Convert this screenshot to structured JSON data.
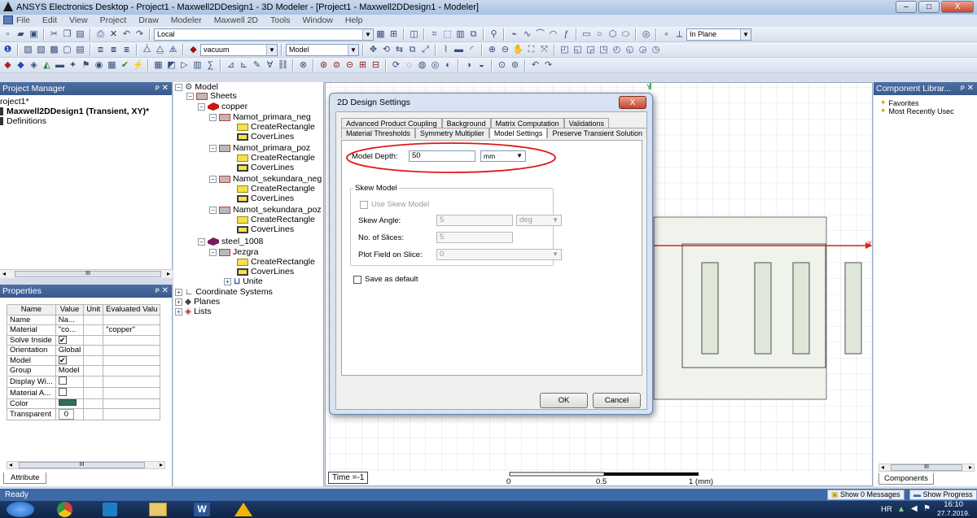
{
  "window": {
    "title": "ANSYS Electronics Desktop - Project1 - Maxwell2DDesign1 - 3D Modeler - [Project1 - Maxwell2DDesign1 - Modeler]",
    "min": "–",
    "max": "□",
    "close": "X"
  },
  "menu": [
    "File",
    "Edit",
    "View",
    "Project",
    "Draw",
    "Modeler",
    "Maxwell 2D",
    "Tools",
    "Window",
    "Help"
  ],
  "toolbar": {
    "coord_combo": "Local",
    "plane_combo": "In Plane",
    "material_combo": "vacuum",
    "model_combo": "Model"
  },
  "project_manager": {
    "title": "Project Manager",
    "project": "roject1*",
    "design": "Maxwell2DDesign1 (Transient, XY)*",
    "definitions": "Definitions",
    "scroll_mark": "III"
  },
  "model_tree": {
    "root": "Model",
    "sheets": "Sheets",
    "copper": "copper",
    "objects": [
      {
        "name": "Namot_primara_neg",
        "ops": [
          "CreateRectangle",
          "CoverLines"
        ]
      },
      {
        "name": "Namot_primara_poz",
        "ops": [
          "CreateRectangle",
          "CoverLines"
        ]
      },
      {
        "name": "Namot_sekundara_neg",
        "ops": [
          "CreateRectangle",
          "CoverLines"
        ]
      },
      {
        "name": "Namot_sekundara_poz",
        "ops": [
          "CreateRectangle",
          "CoverLines"
        ]
      }
    ],
    "steel": "steel_1008",
    "jezgra": "Jezgra",
    "jezgra_ops": [
      "CreateRectangle",
      "CoverLines",
      "Unite"
    ],
    "coordinate_systems": "Coordinate Systems",
    "planes": "Planes",
    "lists": "Lists"
  },
  "properties": {
    "title": "Properties",
    "headers": [
      "Name",
      "Value",
      "Unit",
      "Evaluated Valu"
    ],
    "rows": [
      {
        "name": "Name",
        "value": "Na...",
        "unit": "",
        "evaluated": ""
      },
      {
        "name": "Material",
        "value": "\"co...",
        "unit": "",
        "evaluated": "\"copper\""
      },
      {
        "name": "Solve Inside",
        "value": "✔",
        "unit": "",
        "evaluated": ""
      },
      {
        "name": "Orientation",
        "value": "Global",
        "unit": "",
        "evaluated": ""
      },
      {
        "name": "Model",
        "value": "✔",
        "unit": "",
        "evaluated": ""
      },
      {
        "name": "Group",
        "value": "Model",
        "unit": "",
        "evaluated": ""
      },
      {
        "name": "Display Wi...",
        "value": "",
        "unit": "",
        "evaluated": ""
      },
      {
        "name": "Material A...",
        "value": "",
        "unit": "",
        "evaluated": ""
      },
      {
        "name": "Color",
        "value": "",
        "unit": "",
        "evaluated": ""
      },
      {
        "name": "Transparent",
        "value": "0",
        "unit": "",
        "evaluated": ""
      }
    ],
    "tab": "Attribute",
    "scroll_mark": "III"
  },
  "canvas": {
    "time_label": "Time =-1",
    "scale_ticks": [
      "0",
      "0.5",
      "1 (mm)"
    ],
    "axis_y": "Y",
    "axis_x": "X"
  },
  "component_library": {
    "title": "Component Librar...",
    "favorites": "Favorites",
    "recent": "Most Recently Usec",
    "tab": "Components",
    "scroll_mark": "III"
  },
  "dialog": {
    "title": "2D Design Settings",
    "close": "X",
    "tabs_row1": [
      "Advanced Product Coupling",
      "Background",
      "Matrix Computation",
      "Validations"
    ],
    "tabs_row2": [
      "Material Thresholds",
      "Symmetry Multiplier",
      "Model Settings",
      "Preserve Transient Solution"
    ],
    "model_depth_label": "Model Depth:",
    "model_depth_value": "50",
    "model_depth_unit": "mm",
    "skew_group": "Skew Model",
    "use_skew": "Use Skew Model",
    "skew_angle_label": "Skew Angle:",
    "skew_angle_value": "5",
    "skew_angle_unit": "deg",
    "slices_label": "No. of Slices:",
    "slices_value": "5",
    "plot_field_label": "Plot Field on Slice:",
    "plot_field_value": "0",
    "save_default": "Save as default",
    "ok": "OK",
    "cancel": "Cancel"
  },
  "status": {
    "text": "Ready",
    "messages": "Show 0 Messages",
    "progress": "Show Progress"
  },
  "taskbar": {
    "lang": "HR",
    "time": "16:10",
    "date": "27.7.2019."
  }
}
